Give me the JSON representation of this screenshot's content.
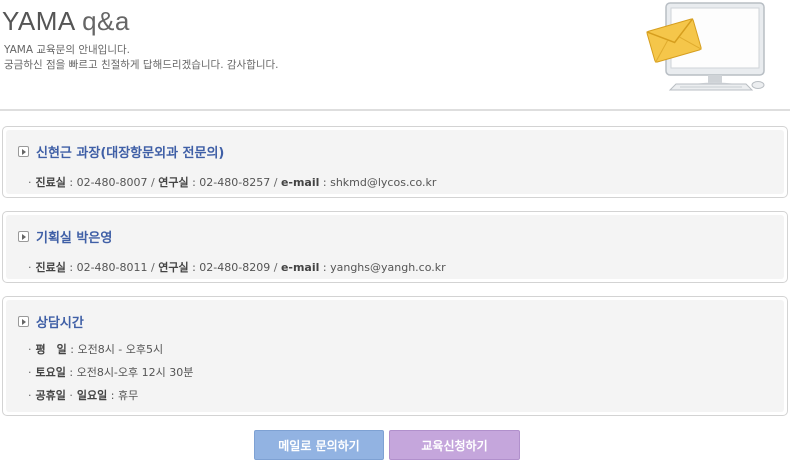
{
  "header": {
    "brand": "YAMA",
    "title_suffix": "q&a",
    "intro_line1": "YAMA 교육문의 안내입니다.",
    "intro_line2": "궁금하신 점을 빠르고 친절하게 답해드리겠습니다. 감사합니다."
  },
  "contacts": [
    {
      "name": "신현근 과장(대장항문외과 전문의)",
      "clinic_label": "진료실",
      "clinic_phone": "02-480-8007",
      "lab_label": "연구실",
      "lab_phone": "02-480-8257",
      "email_label": "e-mail",
      "email": "shkmd@lycos.co.kr"
    },
    {
      "name": "기획실 박은영",
      "clinic_label": "진료실",
      "clinic_phone": "02-480-8011",
      "lab_label": "연구실",
      "lab_phone": "02-480-8209",
      "email_label": "e-mail",
      "email": "yanghs@yangh.co.kr"
    }
  ],
  "hours": {
    "title": "상담시간",
    "weekday_label": "평　일",
    "weekday_value": "오전8시 - 오후5시",
    "saturday_label": "토요일",
    "saturday_value": "오전8시-오후 12시 30분",
    "holiday_label": "공휴일",
    "sunday_label": "일요일",
    "holiday_value": "휴무"
  },
  "buttons": {
    "mail": "메일로 문의하기",
    "apply": "교육신청하기"
  },
  "colors": {
    "accent_blue": "#3f5fa6",
    "mail_button": "#92b3e2",
    "apply_button": "#c5a6dc"
  },
  "icons": {
    "illustration": "monitor-envelope-icon",
    "bullet": "arrow-box-icon"
  }
}
